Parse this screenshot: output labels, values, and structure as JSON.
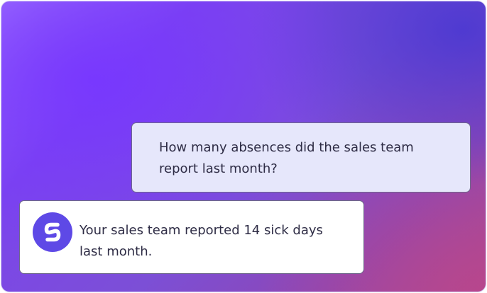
{
  "chat": {
    "user_message": "How many absences did the sales team report last month?",
    "bot_message": "Your sales team reported 14 sick days last month.",
    "avatar_icon": "assistant-logo-icon"
  },
  "colors": {
    "avatar": "#5e49e6",
    "user_bubble": "#e6e7fb",
    "bot_bubble": "#ffffff"
  }
}
